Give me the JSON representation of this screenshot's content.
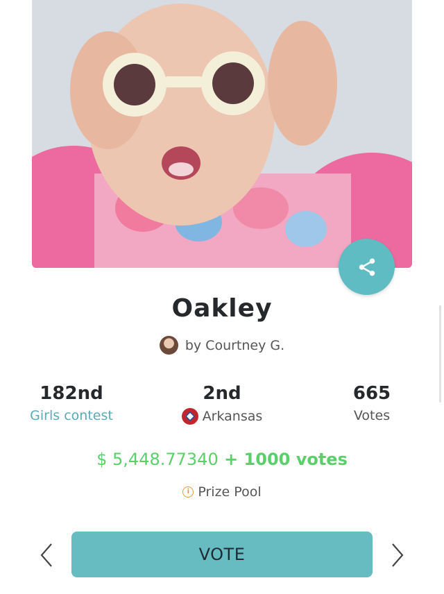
{
  "entry": {
    "name": "Oakley",
    "author": "by Courtney G."
  },
  "stats": {
    "contest_rank": "182nd",
    "contest_label": "Girls contest",
    "state_rank": "2nd",
    "state_label": "Arkansas",
    "votes_count": "665",
    "votes_label": "Votes"
  },
  "prize": {
    "amount": "$ 5,448.77340",
    "plus": " + ",
    "votes_bonus": "1000 votes",
    "pool_label": "Prize Pool"
  },
  "actions": {
    "vote_label": "VOTE"
  },
  "colors": {
    "accent": "#67bcc2",
    "prize_green": "#5bd06a"
  }
}
